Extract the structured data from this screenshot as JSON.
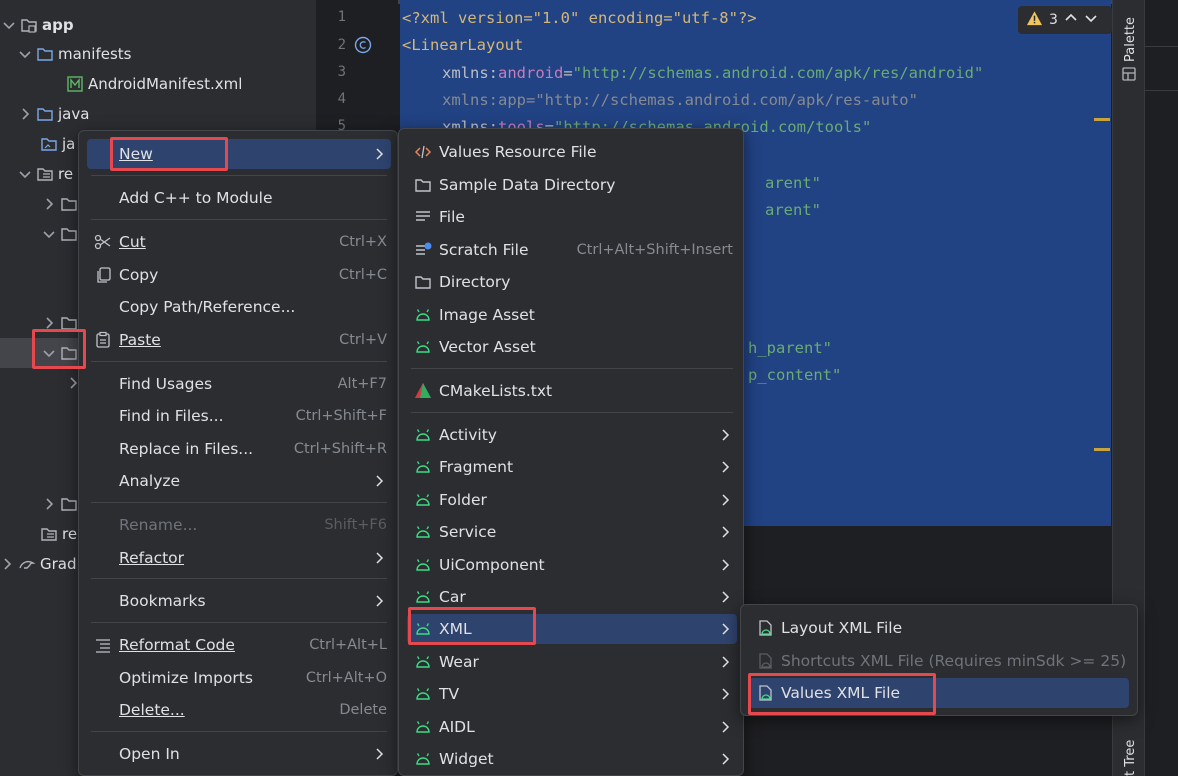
{
  "tree": {
    "items": [
      {
        "label": "app"
      },
      {
        "label": "manifests"
      },
      {
        "label": "AndroidManifest.xml"
      },
      {
        "label": "java"
      },
      {
        "label": "ja"
      },
      {
        "label": "re"
      },
      {
        "label": "re"
      },
      {
        "label": "Grad"
      }
    ]
  },
  "editor": {
    "line_numbers": [
      "1",
      "2",
      "3",
      "4",
      "5"
    ],
    "lines": {
      "l1": {
        "text": "<?xml version=\"1.0\" encoding=\"utf-8\"?>"
      },
      "l2": {
        "tag": "<LinearLayout"
      },
      "l3": {
        "attr": "xmlns:",
        "ns": "android",
        "eq": "=",
        "val": "\"http://schemas.android.com/apk/res/android\""
      },
      "l4": {
        "text": "xmlns:app=\"http://schemas.android.com/apk/res-auto\""
      },
      "l5": {
        "attr": "xmlns:",
        "ns": "tools",
        "eq": "=",
        "val": "\"http://schemas.android.com/tools\""
      },
      "f1": "arent\"",
      "f2": "arent\"",
      "f3": "h_parent\"",
      "f4": "p_content\""
    },
    "warnings_count": "3"
  },
  "right_strip": {
    "palette": "Palette",
    "tree": "t Tree"
  },
  "context_menu": {
    "new": "New",
    "add_cpp": "Add C++ to Module",
    "cut": "Cut",
    "cut_sc": "Ctrl+X",
    "copy": "Copy",
    "copy_sc": "Ctrl+C",
    "copy_path": "Copy Path/Reference...",
    "paste": "Paste",
    "paste_sc": "Ctrl+V",
    "find_usages": "Find Usages",
    "find_usages_sc": "Alt+F7",
    "find_in_files": "Find in Files...",
    "find_in_files_sc": "Ctrl+Shift+F",
    "replace_in_files": "Replace in Files...",
    "replace_in_files_sc": "Ctrl+Shift+R",
    "analyze": "Analyze",
    "rename": "Rename...",
    "rename_sc": "Shift+F6",
    "refactor": "Refactor",
    "bookmarks": "Bookmarks",
    "reformat": "Reformat Code",
    "reformat_sc": "Ctrl+Alt+L",
    "optimize": "Optimize Imports",
    "optimize_sc": "Ctrl+Alt+O",
    "delete": "Delete...",
    "delete_sc": "Delete",
    "open_in": "Open In"
  },
  "new_menu": {
    "values_resource_file": "Values Resource File",
    "sample_data_directory": "Sample Data Directory",
    "file": "File",
    "scratch_file": "Scratch File",
    "scratch_file_sc": "Ctrl+Alt+Shift+Insert",
    "directory": "Directory",
    "image_asset": "Image Asset",
    "vector_asset": "Vector Asset",
    "cmakelists": "CMakeLists.txt",
    "activity": "Activity",
    "fragment": "Fragment",
    "folder": "Folder",
    "service": "Service",
    "uicomponent": "UiComponent",
    "car": "Car",
    "xml": "XML",
    "wear": "Wear",
    "tv": "TV",
    "aidl": "AIDL",
    "widget": "Widget"
  },
  "xml_menu": {
    "layout_xml": "Layout XML File",
    "shortcuts_xml": "Shortcuts XML File (Requires minSdk >= 25)",
    "values_xml": "Values XML File"
  },
  "colors": {
    "highlight_box": "#e5484d",
    "selection": "#214283",
    "menu_hover": "#2e436e",
    "android_green": "#3ddc84"
  }
}
